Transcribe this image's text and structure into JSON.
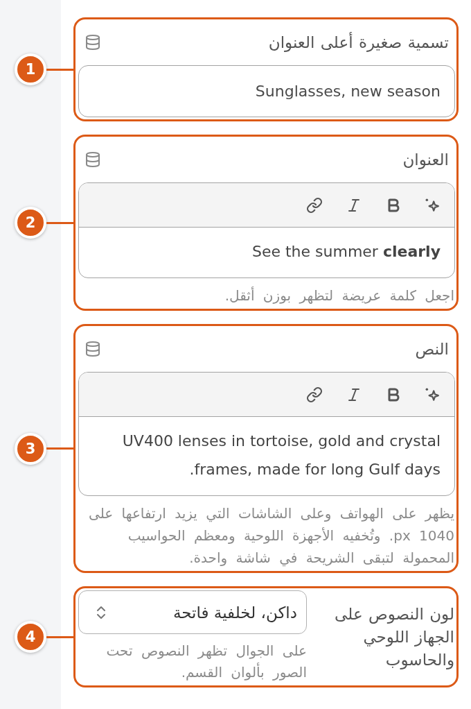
{
  "fields": [
    {
      "marker": "1",
      "kind": "text",
      "label": "تسمية صغيرة أعلى العنوان",
      "value": "Sunglasses, new season"
    },
    {
      "marker": "2",
      "kind": "rich_text",
      "label": "العنوان",
      "value": "See the summer **clearly**",
      "help": "اجعل كلمة عريضة لتظهر بوزن أثقل."
    },
    {
      "marker": "3",
      "kind": "rich_text",
      "label": "النص",
      "value": "UV400 lenses in tortoise, gold and crystal frames, made for long Gulf days.",
      "help": "يظهر على الهواتف وعلى الشاشات التي يزيد ارتفاعها على 1040 px. وتُخفيه الأجهزة اللوحية ومعظم الحواسيب المحمولة لتبقى الشريحة في شاشة واحدة."
    },
    {
      "marker": "4",
      "kind": "select",
      "label": "لون النصوص على الجهاز اللوحي والحاسوب",
      "value": "داكن، لخلفية فاتحة",
      "help": "على الجوال تظهر النصوص تحت الصور بألوان القسم."
    }
  ]
}
